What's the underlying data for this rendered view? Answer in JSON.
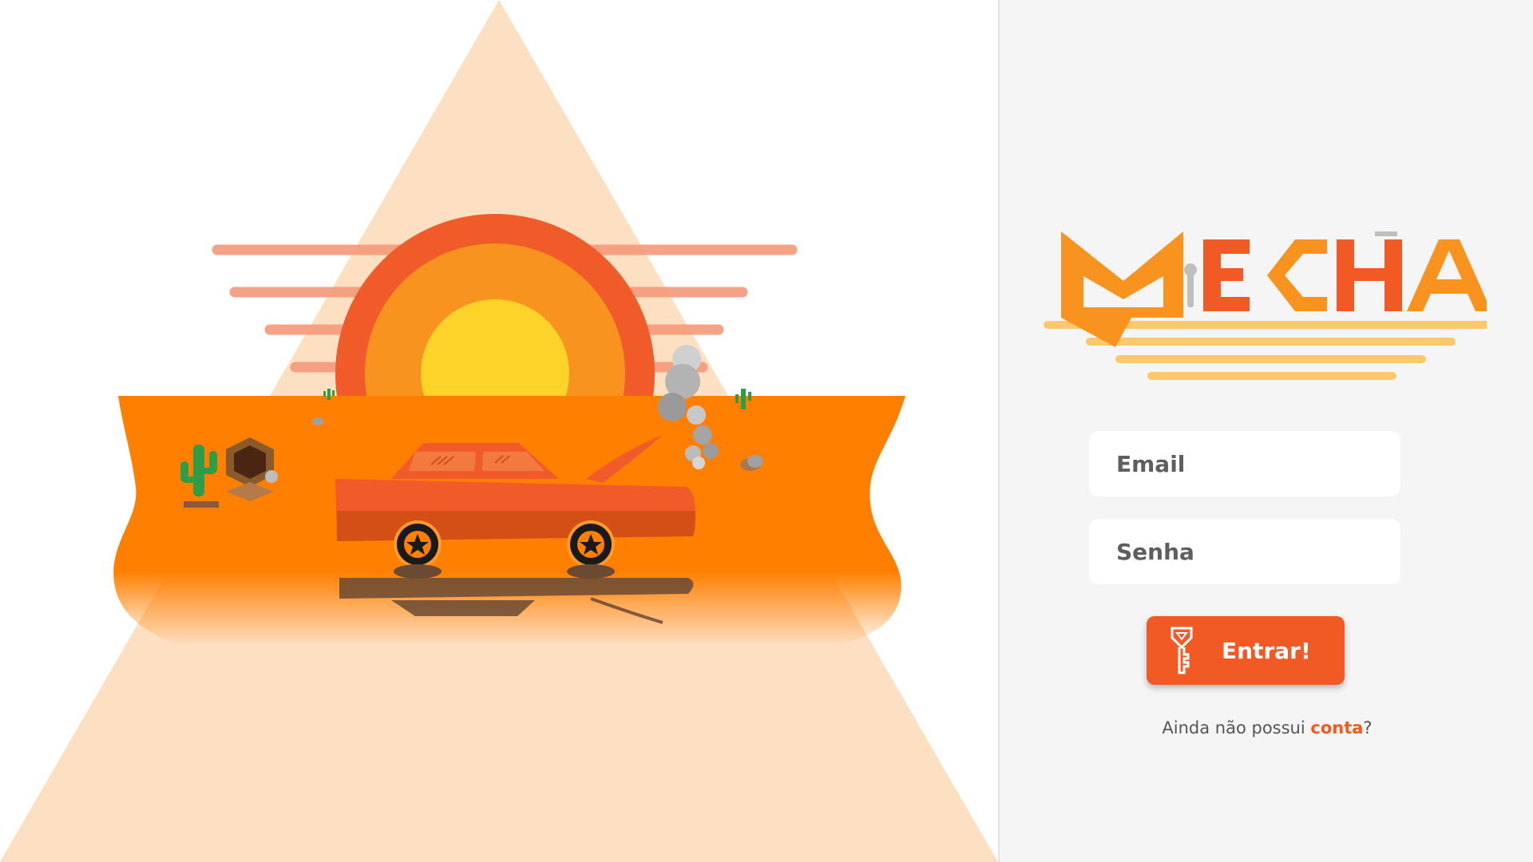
{
  "colors": {
    "accent": "#f15a24",
    "orange_ground": "#ff7f00",
    "sun_outer": "#f15a29",
    "sun_middle": "#f7931e",
    "sun_core": "#fdd329",
    "triangle": "#fddfc2",
    "panel_bg": "#f5f5f5",
    "logo_orange": "#f7931e",
    "logo_red": "#f15a24",
    "logo_lines": "#fbc96b"
  },
  "hero": {
    "icons": [
      "sun",
      "car-broken-down",
      "cactus",
      "smoke",
      "rocks",
      "tire-stack"
    ]
  },
  "logo": {
    "text": "MECHA"
  },
  "login": {
    "email_placeholder": "Email",
    "password_placeholder": "Senha",
    "submit_label": "Entrar!",
    "submit_icon": "key-icon",
    "signup_prefix": "Ainda não possui ",
    "signup_link": "conta",
    "signup_suffix": "?"
  }
}
